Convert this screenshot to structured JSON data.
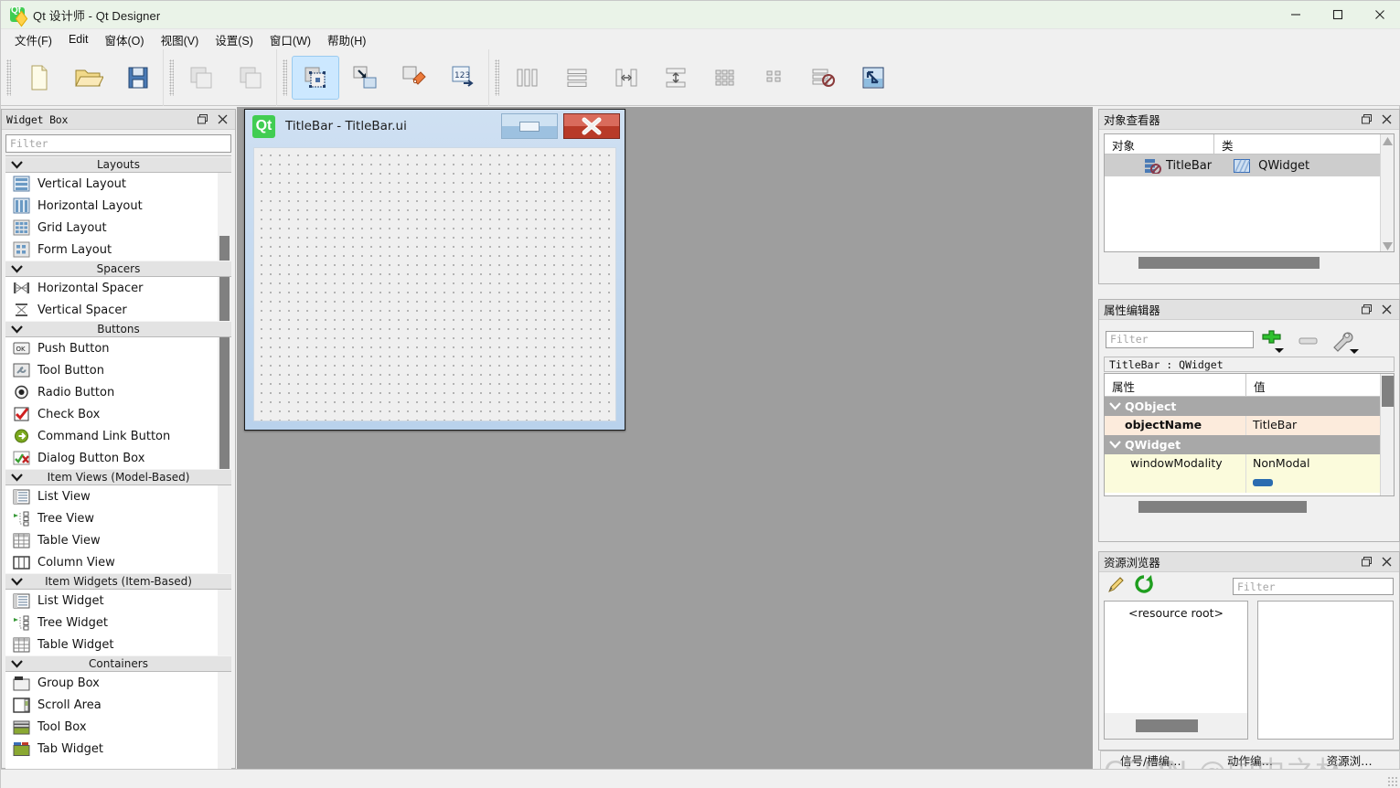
{
  "window": {
    "title": "Qt 设计师 - Qt Designer",
    "app_icon": "qt-designer-icon",
    "minimize": "minimize-icon",
    "maximize": "maximize-icon",
    "close": "close-icon"
  },
  "menubar": {
    "items": [
      {
        "label": "文件(F)",
        "name": "menu-file"
      },
      {
        "label": "Edit",
        "name": "menu-edit"
      },
      {
        "label": "窗体(O)",
        "name": "menu-form"
      },
      {
        "label": "视图(V)",
        "name": "menu-view"
      },
      {
        "label": "设置(S)",
        "name": "menu-settings"
      },
      {
        "label": "窗口(W)",
        "name": "menu-window"
      },
      {
        "label": "帮助(H)",
        "name": "menu-help"
      }
    ]
  },
  "toolbar": {
    "groups": [
      {
        "buttons": [
          {
            "name": "new-form-button",
            "icon": "new-document-icon",
            "active": false
          },
          {
            "name": "open-form-button",
            "icon": "open-folder-icon",
            "active": false
          },
          {
            "name": "save-form-button",
            "icon": "floppy-save-icon",
            "active": false
          }
        ]
      },
      {
        "buttons": [
          {
            "name": "undo-button",
            "icon": "undo-icon",
            "active": false
          },
          {
            "name": "redo-button",
            "icon": "redo-icon",
            "active": false
          }
        ]
      },
      {
        "buttons": [
          {
            "name": "edit-widgets-button",
            "icon": "edit-widgets-icon",
            "active": true
          },
          {
            "name": "edit-signals-slots-button",
            "icon": "signals-slots-icon",
            "active": false
          },
          {
            "name": "edit-buddies-button",
            "icon": "buddies-icon",
            "active": false
          },
          {
            "name": "edit-tab-order-button",
            "icon": "tab-order-icon",
            "active": false
          }
        ]
      },
      {
        "buttons": [
          {
            "name": "layout-horizontally-button",
            "icon": "layout-horizontal-icon",
            "active": false
          },
          {
            "name": "layout-vertically-button",
            "icon": "layout-vertical-icon",
            "active": false
          },
          {
            "name": "layout-splitter-horizontal-button",
            "icon": "splitter-horizontal-icon",
            "active": false
          },
          {
            "name": "layout-splitter-vertical-button",
            "icon": "splitter-vertical-icon",
            "active": false
          },
          {
            "name": "layout-grid-button",
            "icon": "layout-grid-icon",
            "active": false
          },
          {
            "name": "layout-form-button",
            "icon": "layout-form-icon",
            "active": false
          },
          {
            "name": "break-layout-button",
            "icon": "break-layout-icon",
            "active": false
          },
          {
            "name": "adjust-size-button",
            "icon": "adjust-size-icon",
            "active": false
          }
        ]
      }
    ]
  },
  "widget_box": {
    "title": "Widget Box",
    "float_icon": "float-icon",
    "close_icon": "close-icon",
    "filter_placeholder": "Filter",
    "categories": [
      {
        "name": "Layouts",
        "items": [
          {
            "label": "Vertical Layout",
            "icon": "vertical-layout-icon"
          },
          {
            "label": "Horizontal Layout",
            "icon": "horizontal-layout-icon"
          },
          {
            "label": "Grid Layout",
            "icon": "grid-layout-icon"
          },
          {
            "label": "Form Layout",
            "icon": "form-layout-icon"
          }
        ]
      },
      {
        "name": "Spacers",
        "items": [
          {
            "label": "Horizontal Spacer",
            "icon": "horizontal-spacer-icon"
          },
          {
            "label": "Vertical Spacer",
            "icon": "vertical-spacer-icon"
          }
        ]
      },
      {
        "name": "Buttons",
        "items": [
          {
            "label": "Push Button",
            "icon": "push-button-icon"
          },
          {
            "label": "Tool Button",
            "icon": "tool-button-icon"
          },
          {
            "label": "Radio Button",
            "icon": "radio-button-icon"
          },
          {
            "label": "Check Box",
            "icon": "check-box-icon"
          },
          {
            "label": "Command Link Button",
            "icon": "command-link-icon"
          },
          {
            "label": "Dialog Button Box",
            "icon": "dialog-button-box-icon"
          }
        ]
      },
      {
        "name": "Item Views (Model-Based)",
        "items": [
          {
            "label": "List View",
            "icon": "list-view-icon"
          },
          {
            "label": "Tree View",
            "icon": "tree-view-icon"
          },
          {
            "label": "Table View",
            "icon": "table-view-icon"
          },
          {
            "label": "Column View",
            "icon": "column-view-icon"
          }
        ]
      },
      {
        "name": "Item Widgets (Item-Based)",
        "items": [
          {
            "label": "List Widget",
            "icon": "list-widget-icon"
          },
          {
            "label": "Tree Widget",
            "icon": "tree-widget-icon"
          },
          {
            "label": "Table Widget",
            "icon": "table-widget-icon"
          }
        ]
      },
      {
        "name": "Containers",
        "items": [
          {
            "label": "Group Box",
            "icon": "group-box-icon"
          },
          {
            "label": "Scroll Area",
            "icon": "scroll-area-icon"
          },
          {
            "label": "Tool Box",
            "icon": "tool-box-icon"
          },
          {
            "label": "Tab Widget",
            "icon": "tab-widget-icon"
          }
        ]
      }
    ]
  },
  "form": {
    "icon": "qt-logo-icon",
    "title": "TitleBar - TitleBar.ui",
    "minimize_button": "minimize-icon",
    "close_button": "close-icon"
  },
  "object_inspector": {
    "title": "对象查看器",
    "float_icon": "float-icon",
    "close_icon": "close-icon",
    "columns": [
      "对象",
      "类"
    ],
    "rows": [
      {
        "object": "TitleBar",
        "class": "QWidget",
        "object_icon": "widget-node-icon",
        "class_icon": "qwidget-icon"
      }
    ]
  },
  "property_editor": {
    "title": "属性编辑器",
    "float_icon": "float-icon",
    "close_icon": "close-icon",
    "filter_placeholder": "Filter",
    "add_button": "add-plus-icon",
    "remove_button": "remove-minus-icon",
    "configure_button": "wrench-configure-icon",
    "object_line": "TitleBar : QWidget",
    "columns": [
      "属性",
      "值"
    ],
    "groups": [
      {
        "name": "QObject",
        "properties": [
          {
            "key": "objectName",
            "value": "TitleBar"
          }
        ]
      },
      {
        "name": "QWidget",
        "properties": [
          {
            "key": "windowModality",
            "value": "NonModal"
          }
        ]
      }
    ]
  },
  "resource_browser": {
    "title": "资源浏览器",
    "float_icon": "float-icon",
    "close_icon": "close-icon",
    "edit_button": "pencil-edit-icon",
    "reload_button": "reload-green-icon",
    "filter_placeholder": "Filter",
    "root_label": "<resource root>"
  },
  "bottom_tabs": [
    {
      "label": "信号/槽编…",
      "name": "tab-signal-slot-editor"
    },
    {
      "label": "动作编…",
      "name": "tab-action-editor"
    },
    {
      "label": "资源浏…",
      "name": "tab-resource-browser"
    }
  ],
  "watermark": "CSDN @国中之林",
  "colors": {
    "titlebar_bg": "#eaf3e8",
    "toolbar_active": "#cce8ff",
    "canvas_bg": "#9e9e9e",
    "qt_green": "#41cd52",
    "close_red": "#b83a28",
    "property_row_peach": "#fcebdc",
    "property_row_yellow": "#fbfbdc",
    "group_header_gray": "#a8a8a8"
  }
}
